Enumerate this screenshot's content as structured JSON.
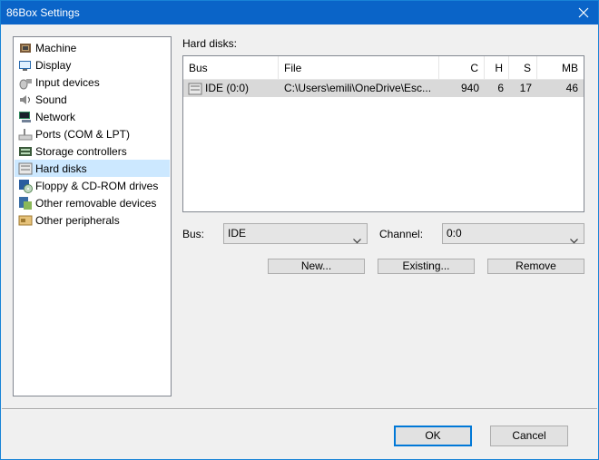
{
  "window": {
    "title": "86Box Settings"
  },
  "sidebar": {
    "items": [
      {
        "label": "Machine",
        "icon": "machine-icon"
      },
      {
        "label": "Display",
        "icon": "display-icon"
      },
      {
        "label": "Input devices",
        "icon": "input-devices-icon"
      },
      {
        "label": "Sound",
        "icon": "sound-icon"
      },
      {
        "label": "Network",
        "icon": "network-icon"
      },
      {
        "label": "Ports (COM & LPT)",
        "icon": "ports-icon"
      },
      {
        "label": "Storage controllers",
        "icon": "storage-controllers-icon"
      },
      {
        "label": "Hard disks",
        "icon": "hard-disk-icon",
        "selected": true
      },
      {
        "label": "Floppy & CD-ROM drives",
        "icon": "floppy-cdrom-icon"
      },
      {
        "label": "Other removable devices",
        "icon": "removable-devices-icon"
      },
      {
        "label": "Other peripherals",
        "icon": "peripherals-icon"
      }
    ]
  },
  "hard_disks": {
    "section_label": "Hard disks:",
    "columns": [
      "Bus",
      "File",
      "C",
      "H",
      "S",
      "MB"
    ],
    "rows": [
      {
        "bus": "IDE (0:0)",
        "file": "C:\\Users\\emili\\OneDrive\\Esc...",
        "c": "940",
        "h": "6",
        "s": "17",
        "mb": "46"
      }
    ]
  },
  "form": {
    "bus_label": "Bus:",
    "bus_value": "IDE",
    "channel_label": "Channel:",
    "channel_value": "0:0"
  },
  "buttons": {
    "new": "New...",
    "existing": "Existing...",
    "remove": "Remove",
    "ok": "OK",
    "cancel": "Cancel"
  },
  "colors": {
    "titlebar": "#0a64c8",
    "selection": "#cce8ff",
    "default_button_border": "#0078d7"
  }
}
